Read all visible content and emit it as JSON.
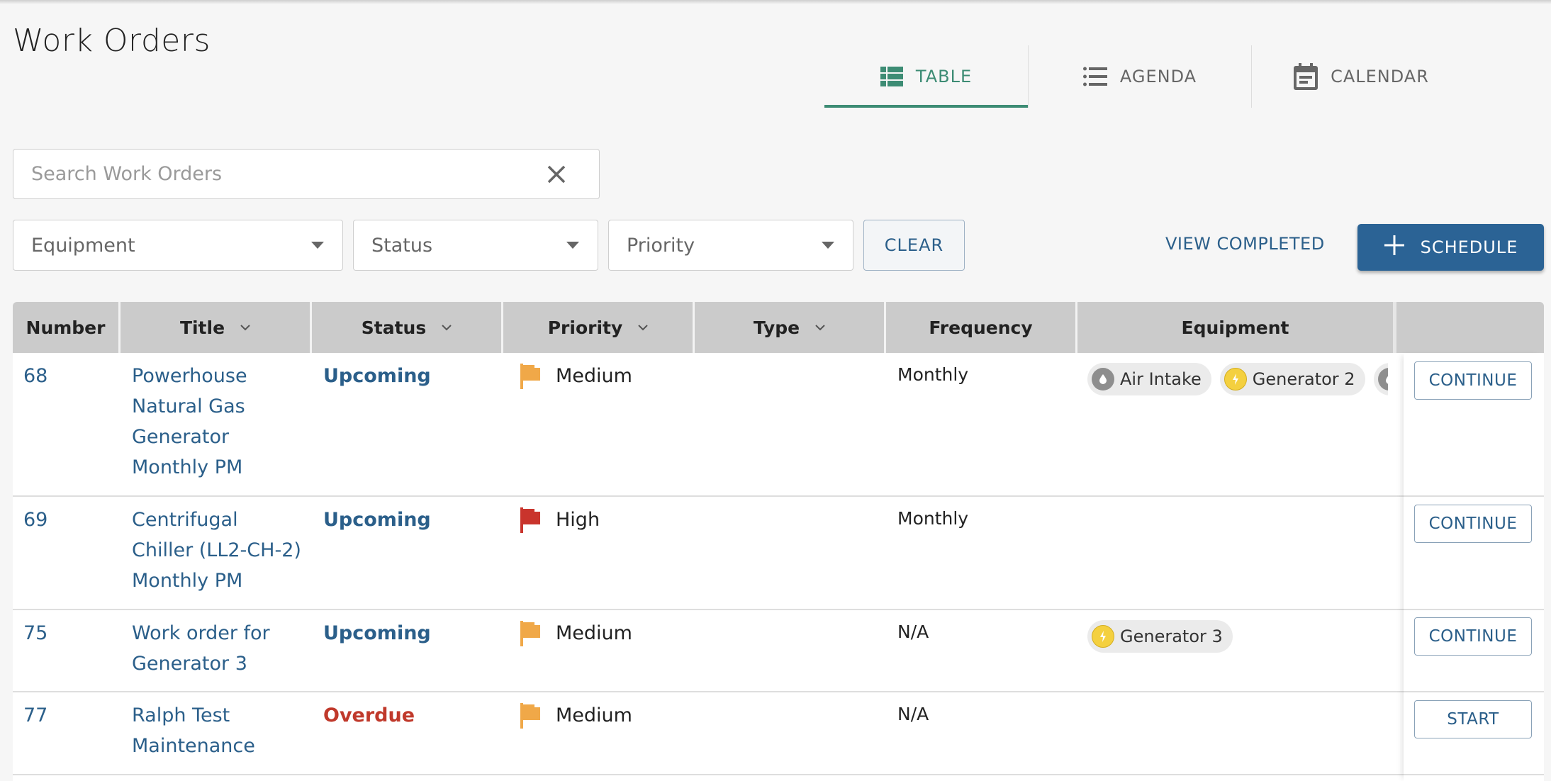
{
  "page": {
    "title": "Work Orders"
  },
  "view_tabs": [
    {
      "label": "TABLE",
      "icon": "table-icon",
      "active": true
    },
    {
      "label": "AGENDA",
      "icon": "list-icon",
      "active": false
    },
    {
      "label": "CALENDAR",
      "icon": "calendar-icon",
      "active": false
    }
  ],
  "search": {
    "placeholder": "Search Work Orders",
    "value": "",
    "clear_icon": "close-icon"
  },
  "filters": {
    "equipment": {
      "placeholder": "Equipment"
    },
    "status": {
      "placeholder": "Status"
    },
    "priority": {
      "placeholder": "Priority"
    },
    "clear_label": "CLEAR"
  },
  "actions": {
    "view_completed_label": "VIEW COMPLETED",
    "schedule_label": "SCHEDULE",
    "schedule_icon": "plus-icon"
  },
  "table": {
    "columns": [
      {
        "label": "Number",
        "sortable": false
      },
      {
        "label": "Title",
        "sortable": true
      },
      {
        "label": "Status",
        "sortable": true
      },
      {
        "label": "Priority",
        "sortable": true
      },
      {
        "label": "Type",
        "sortable": true
      },
      {
        "label": "Frequency",
        "sortable": false
      },
      {
        "label": "Equipment",
        "sortable": false
      },
      {
        "label": "",
        "sortable": false
      }
    ],
    "rows": [
      {
        "number": "68",
        "title": "Powerhouse Natural Gas Generator Monthly PM",
        "status": "Upcoming",
        "priority": "Medium",
        "type": "",
        "frequency": "Monthly",
        "equipment": [
          {
            "name": "Air Intake",
            "icon": "droplet-icon",
            "color": "#8e8e8e"
          },
          {
            "name": "Generator 2",
            "icon": "lightning-icon",
            "color": "#f4d03f"
          },
          {
            "name": "",
            "icon": "droplet-icon",
            "color": "#8e8e8e"
          }
        ],
        "action": "CONTINUE"
      },
      {
        "number": "69",
        "title": "Centrifugal Chiller (LL2-CH-2) Monthly PM",
        "status": "Upcoming",
        "priority": "High",
        "type": "",
        "frequency": "Monthly",
        "equipment": [],
        "action": "CONTINUE"
      },
      {
        "number": "75",
        "title": "Work order for Generator 3",
        "status": "Upcoming",
        "priority": "Medium",
        "type": "",
        "frequency": "N/A",
        "equipment": [
          {
            "name": "Generator 3",
            "icon": "lightning-icon",
            "color": "#f4d03f"
          }
        ],
        "action": "CONTINUE"
      },
      {
        "number": "77",
        "title": "Ralph Test Maintenance",
        "status": "Overdue",
        "priority": "Medium",
        "type": "",
        "frequency": "N/A",
        "equipment": [],
        "action": "START"
      }
    ]
  },
  "colors": {
    "accent_green": "#3d8c74",
    "primary_blue": "#2b6395",
    "link_blue": "#2b5f8a",
    "status_upcoming": "#2b5f8a",
    "status_overdue": "#c0392b",
    "priority_medium": "#f0a848",
    "priority_high": "#c9342c"
  }
}
